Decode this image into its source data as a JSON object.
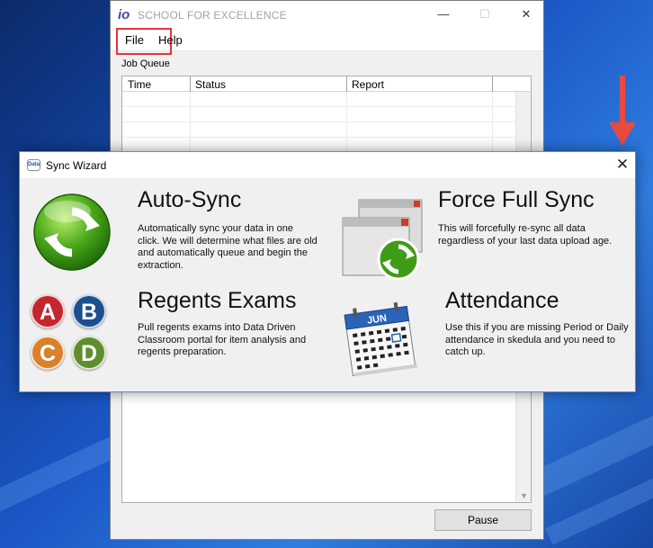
{
  "main_window": {
    "title": "SCHOOL FOR EXCELLENCE",
    "logo_text": "io",
    "minimize_glyph": "—",
    "maximize_glyph": "☐",
    "close_glyph": "✕",
    "menu": {
      "file": "File",
      "help": "Help"
    },
    "job_queue_label": "Job Queue",
    "columns": [
      "Time",
      "Status",
      "Report"
    ],
    "pause_label": "Pause"
  },
  "wizard": {
    "title": "Sync Wizard",
    "logo_text": "Data",
    "close_glyph": "✕",
    "options": [
      {
        "title": "Auto-Sync",
        "description": "Automatically sync your data in one click. We will determine what files are old and automatically queue and begin the extraction.",
        "icon": "auto-sync-icon"
      },
      {
        "title": "Force Full Sync",
        "description": "This will forcefully re-sync all data regardless of your last data upload age.",
        "icon": "force-full-sync-icon"
      },
      {
        "title": "Regents Exams",
        "description": "Pull regents exams into Data Driven Classroom portal for item analysis and regents preparation.",
        "icon": "regents-exams-icon",
        "letters": [
          "A",
          "B",
          "C",
          "D"
        ]
      },
      {
        "title": "Attendance",
        "description": "Use this if you are missing Period or Daily attendance in skedula and you need to catch up.",
        "icon": "calendar-icon",
        "month": "JUN"
      }
    ]
  },
  "colors": {
    "highlight_box": "#e5343b",
    "arrow": "#e94a40",
    "letter_a": "#c4262e",
    "letter_b": "#1d4f8f",
    "letter_c": "#d9812b",
    "letter_d": "#5e8f2c"
  }
}
